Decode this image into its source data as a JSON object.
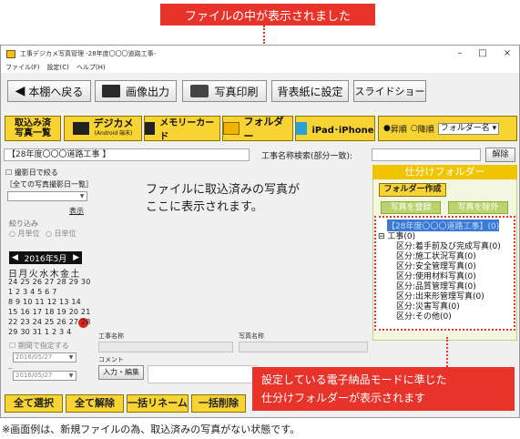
{
  "callouts": {
    "top": "ファイルの中が表示されました",
    "bottom_right_line1": "設定している電子納品モードに準じた",
    "bottom_right_line2": "仕分けフォルダーが表示されます"
  },
  "window": {
    "title": "工事デジカメ写真管理 -28年度〇〇〇道路工事-",
    "controls": [
      "–",
      "□",
      "×"
    ],
    "menu": [
      "ファイル(F)",
      "設定(C)",
      "ヘルプ(H)"
    ]
  },
  "toolbar": {
    "back": "本棚へ戻る",
    "image_output": "画像出力",
    "photo_print": "写真印刷",
    "background": "背表紙に設定",
    "slideshow": "スライドショー"
  },
  "import_bar": {
    "imported_list_line1": "取込み済",
    "imported_list_line2": "写真一覧",
    "digicam": "デジカメ",
    "digicam_sub": "(Android 端末)",
    "memory_card": "メモリーカード",
    "folder": "フォルダー",
    "ipad": "iPad･iPhone",
    "sort_asc": "昇順",
    "sort_desc": "降順",
    "sort_key": "フォルダー名"
  },
  "pathbar": {
    "project": "【28年度〇〇〇道路工事 】",
    "search_label": "工事名称検索(部分一致):",
    "clear": "解除"
  },
  "left": {
    "narrow_by_date": "撮影日で絞る",
    "date_list": "［全ての写真撮影日一覧］",
    "show": "表示",
    "filter": "絞り込み",
    "unit_month": "月単位",
    "unit_day": "日単位",
    "calendar_title": "2016年5月",
    "weekdays": "日月火水木金土",
    "weeks": [
      "24 25 26 27 28 29 30",
      " 1  2  3  4  5  6  7",
      " 8  9 10 11 12 13 14",
      "15 16 17 18 19 20 21",
      "22 23 24 25 26 27 28",
      "29 30 31  1  2  3  4"
    ],
    "today": "27",
    "period": "期間で指定する",
    "date_from": "2016/05/27",
    "date_to": "2016/05/27"
  },
  "center": {
    "message_line1": "ファイルに取込済みの写真が",
    "message_line2": "ここに表示されます。",
    "work_name_label": "工事名称",
    "photo_name_label": "写真名称",
    "comment_label": "コメント",
    "edit_button": "入力・編集"
  },
  "right": {
    "header": "仕分けフォルダー",
    "create_folder": "フォルダー作成",
    "register_photo": "写真を登録",
    "remove_photo": "写真を除外",
    "tree_root": "【28年度〇〇〇道路工事】(0)",
    "tree_work": "工事(0)",
    "tree_items": [
      "区分:着手前及び完成写真(0)",
      "区分:施工状況写真(0)",
      "区分:安全管理写真(0)",
      "区分:使用材料写真(0)",
      "区分:品質管理写真(0)",
      "区分:出来形管理写真(0)",
      "区分:災害写真(0)",
      "区分:その他(0)"
    ]
  },
  "bottom": {
    "select_all": "全て選択",
    "deselect_all": "全て解除",
    "batch_rename": "一括リネーム",
    "batch_delete": "一括削除"
  },
  "footnote": "※画面例は、新規ファイルの為、取込済みの写真がない状態です。",
  "colors": {
    "accent_red": "#e8332b",
    "button_yellow": "#f7d334",
    "folder_header": "#f1c400",
    "tree_select": "#3a7bd5"
  }
}
